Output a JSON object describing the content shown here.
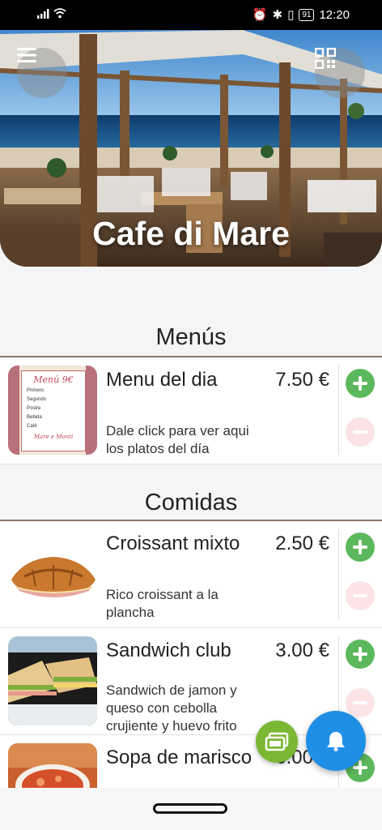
{
  "status_bar": {
    "time": "12:20",
    "battery": "91"
  },
  "hero": {
    "title": "Cafe di Mare"
  },
  "sections": [
    {
      "title": "Menús",
      "items": [
        {
          "name": "Menu del dia",
          "price": "7.50 €",
          "description": "Dale click para ver aqui los platos del día",
          "thumb_text": {
            "heading": "Menú 9€",
            "lines": [
              "Primero",
              "Segundo",
              "Postre",
              "Bebida",
              "Café"
            ],
            "footer": "Mare e Monti"
          }
        }
      ]
    },
    {
      "title": "Comidas",
      "items": [
        {
          "name": "Croissant mixto",
          "price": "2.50 €",
          "description": "Rico croissant a la plancha"
        },
        {
          "name": "Sandwich club",
          "price": "3.00 €",
          "description": "Sandwich de jamon y queso con cebolla crujiente y huevo frito"
        },
        {
          "name": "Sopa de marisco",
          "price": "6.00 €",
          "description": ""
        }
      ]
    }
  ],
  "icons": {
    "menu": "hamburger-icon",
    "qr": "qr-code-icon",
    "add": "plus-icon",
    "remove": "minus-icon",
    "order": "receipt-money-icon",
    "notify": "bell-icon"
  },
  "colors": {
    "add": "#5cb85c",
    "remove": "#fbe3e6",
    "fab_green": "#7ab834",
    "fab_blue": "#1f8fe6",
    "divider": "#8a7568"
  }
}
